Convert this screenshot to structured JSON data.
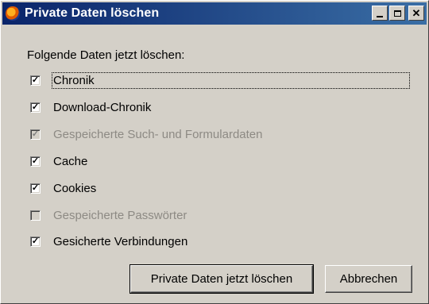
{
  "window": {
    "title": "Private Daten löschen",
    "app_icon": "firefox-icon",
    "controls": {
      "minimize": "minimize-icon",
      "maximize": "maximize-icon",
      "close": "close-icon"
    }
  },
  "heading": "Folgende Daten jetzt löschen:",
  "options": [
    {
      "label": "Chronik",
      "checked": true,
      "enabled": true
    },
    {
      "label": "Download-Chronik",
      "checked": true,
      "enabled": true
    },
    {
      "label": "Gespeicherte Such- und Formulardaten",
      "checked": true,
      "enabled": false
    },
    {
      "label": "Cache",
      "checked": true,
      "enabled": true
    },
    {
      "label": "Cookies",
      "checked": true,
      "enabled": true
    },
    {
      "label": "Gespeicherte Passwörter",
      "checked": false,
      "enabled": false
    },
    {
      "label": "Gesicherte Verbindungen",
      "checked": true,
      "enabled": true
    }
  ],
  "buttons": {
    "clear": "Private Daten jetzt löschen",
    "cancel": "Abbrechen"
  }
}
